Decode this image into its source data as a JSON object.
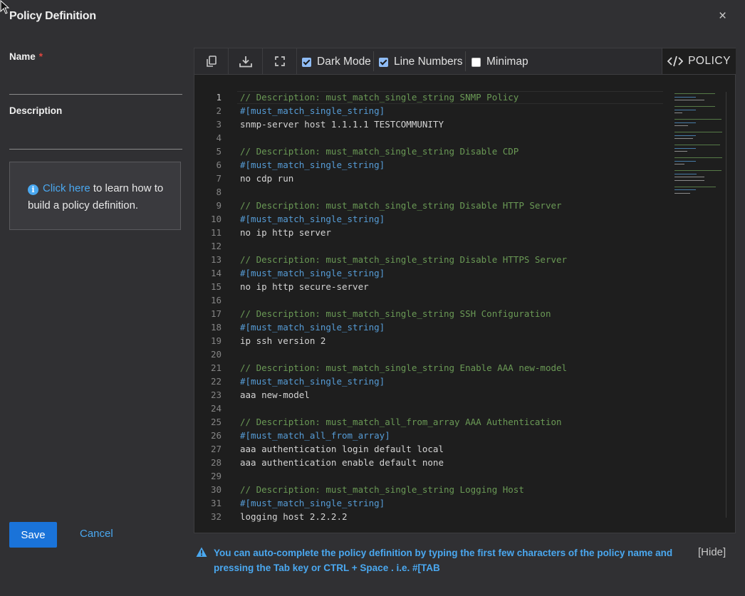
{
  "dialog": {
    "title": "Policy Definition",
    "close_label": "×"
  },
  "form": {
    "name_label": "Name",
    "required_mark": "*",
    "name_value": "",
    "description_label": "Description",
    "description_value": ""
  },
  "info": {
    "link_text": "Click here",
    "text": " to learn how to build a policy definition."
  },
  "buttons": {
    "save": "Save",
    "cancel": "Cancel"
  },
  "toolbar": {
    "copy_icon": "copy-icon",
    "download_icon": "download-icon",
    "fullscreen_icon": "fullscreen-icon",
    "options": [
      {
        "label": "Dark Mode",
        "checked": true
      },
      {
        "label": "Line Numbers",
        "checked": true
      },
      {
        "label": "Minimap",
        "checked": false
      }
    ],
    "policy_tab": "POLICY",
    "policy_icon": "code-icon"
  },
  "editor": {
    "current_line": 1,
    "lines": [
      {
        "n": "1",
        "t": "// Description: must_match_single_string SNMP Policy",
        "k": "com"
      },
      {
        "n": "2",
        "t": "#[must_match_single_string]",
        "k": "tag"
      },
      {
        "n": "3",
        "t": "snmp-server host 1.1.1.1 TESTCOMMUNITY",
        "k": "plain"
      },
      {
        "n": "4",
        "t": "",
        "k": "plain"
      },
      {
        "n": "5",
        "t": "// Description: must_match_single_string Disable CDP",
        "k": "com"
      },
      {
        "n": "6",
        "t": "#[must_match_single_string]",
        "k": "tag"
      },
      {
        "n": "7",
        "t": "no cdp run",
        "k": "plain"
      },
      {
        "n": "8",
        "t": "",
        "k": "plain"
      },
      {
        "n": "9",
        "t": "// Description: must_match_single_string Disable HTTP Server",
        "k": "com"
      },
      {
        "n": "10",
        "t": "#[must_match_single_string]",
        "k": "tag"
      },
      {
        "n": "11",
        "t": "no ip http server",
        "k": "plain"
      },
      {
        "n": "12",
        "t": "",
        "k": "plain"
      },
      {
        "n": "13",
        "t": "// Description: must_match_single_string Disable HTTPS Server",
        "k": "com"
      },
      {
        "n": "14",
        "t": "#[must_match_single_string]",
        "k": "tag"
      },
      {
        "n": "15",
        "t": "no ip http secure-server",
        "k": "plain"
      },
      {
        "n": "16",
        "t": "",
        "k": "plain"
      },
      {
        "n": "17",
        "t": "// Description: must_match_single_string SSH Configuration",
        "k": "com"
      },
      {
        "n": "18",
        "t": "#[must_match_single_string]",
        "k": "tag"
      },
      {
        "n": "19",
        "t": "ip ssh version 2",
        "k": "plain"
      },
      {
        "n": "20",
        "t": "",
        "k": "plain"
      },
      {
        "n": "21",
        "t": "// Description: must_match_single_string Enable AAA new-model",
        "k": "com"
      },
      {
        "n": "22",
        "t": "#[must_match_single_string]",
        "k": "tag"
      },
      {
        "n": "23",
        "t": "aaa new-model",
        "k": "plain"
      },
      {
        "n": "24",
        "t": "",
        "k": "plain"
      },
      {
        "n": "25",
        "t": "// Description: must_match_all_from_array AAA Authentication",
        "k": "com"
      },
      {
        "n": "26",
        "t": "#[must_match_all_from_array]",
        "k": "tag"
      },
      {
        "n": "27",
        "t": "aaa authentication login default local",
        "k": "plain"
      },
      {
        "n": "28",
        "t": "aaa authentication enable default none",
        "k": "plain"
      },
      {
        "n": "29",
        "t": "",
        "k": "plain"
      },
      {
        "n": "30",
        "t": "// Description: must_match_single_string Logging Host",
        "k": "com"
      },
      {
        "n": "31",
        "t": "#[must_match_single_string]",
        "k": "tag"
      },
      {
        "n": "32",
        "t": "logging host 2.2.2.2",
        "k": "plain"
      }
    ]
  },
  "hint": {
    "icon": "warning-icon",
    "text": "You can auto-complete the policy definition by typing the first few characters of the policy name and pressing the Tab key or CTRL + Space . i.e. #[TAB",
    "hide_label": "[Hide]"
  },
  "colors": {
    "background": "#303033",
    "accent": "#1a73d9",
    "link": "#4aa8f0",
    "editor_bg": "#1e1e1e",
    "comment": "#6a9955",
    "tag": "#569cd6"
  }
}
